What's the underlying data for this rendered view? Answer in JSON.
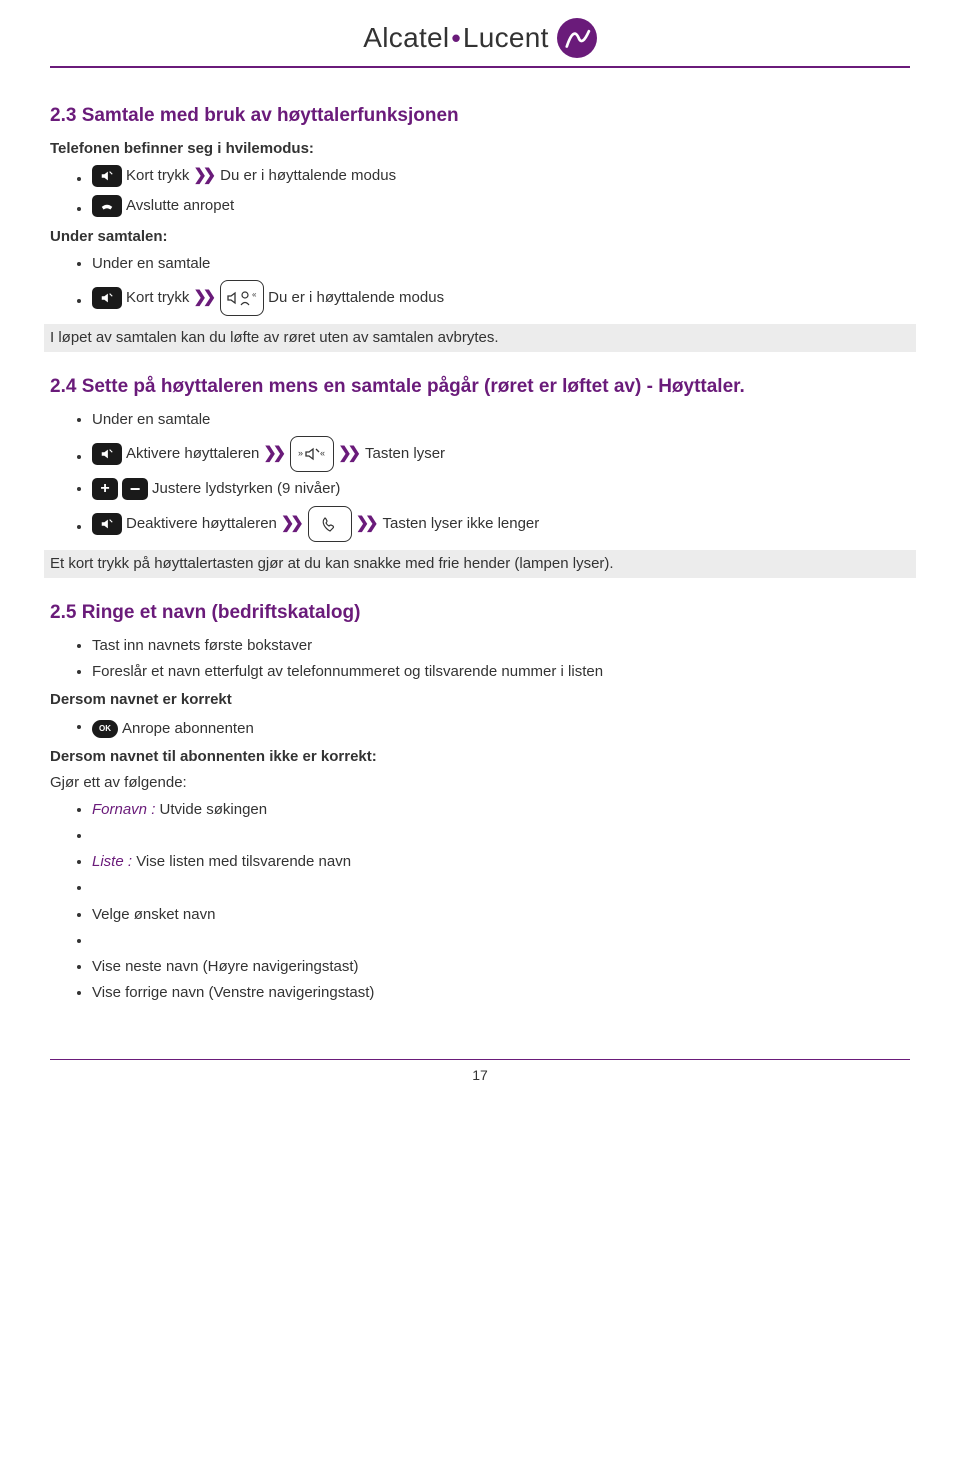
{
  "brand": {
    "name1": "Alcatel",
    "name2": "Lucent"
  },
  "s23": {
    "title": "2.3 Samtale med bruk av høyttalerfunksjonen",
    "idle_heading": "Telefonen befinner seg i hvilemodus:",
    "idle": {
      "shortpress": "Kort trykk",
      "shortpress_result": "Du er i høyttalende modus",
      "hangup": "Avslutte anropet"
    },
    "incall_heading": "Under samtalen:",
    "incall": {
      "during": "Under en samtale",
      "shortpress": "Kort trykk",
      "result": "Du er i høyttalende modus"
    },
    "note": "I løpet av samtalen kan du løfte av røret uten av samtalen avbrytes."
  },
  "s24": {
    "title": "2.4 Sette på høyttaleren mens en samtale pågår (røret er løftet av) - Høyttaler.",
    "during": "Under en samtale",
    "activate": "Aktivere høyttaleren",
    "keylit": "Tasten lyser",
    "volume": "Justere lydstyrken (9 nivåer)",
    "deactivate": "Deaktivere høyttaleren",
    "keyoff": "Tasten lyser ikke lenger",
    "note": "Et kort trykk på høyttalertasten gjør at du kan snakke med frie hender (lampen lyser)."
  },
  "s25": {
    "title": "2.5 Ringe et navn (bedriftskatalog)",
    "typeletters": "Tast inn navnets første bokstaver",
    "suggests": "Foreslår et navn etterfulgt av telefonnummeret og tilsvarende nummer i listen",
    "ifcorrect": "Dersom navnet er korrekt",
    "call": "Anrope abonnenten",
    "ifnot": "Dersom navnet til abonnenten ikke er korrekt:",
    "doone": "Gjør ett av følgende:",
    "fornavn_label": "Fornavn :",
    "fornavn_desc": "Utvide søkingen",
    "liste_label": "Liste :",
    "liste_desc": "Vise listen med tilsvarende navn",
    "choose": "Velge ønsket navn",
    "next": "Vise neste navn (Høyre navigeringstast)",
    "prev": "Vise forrige navn (Venstre navigeringstast)"
  },
  "page": "17"
}
